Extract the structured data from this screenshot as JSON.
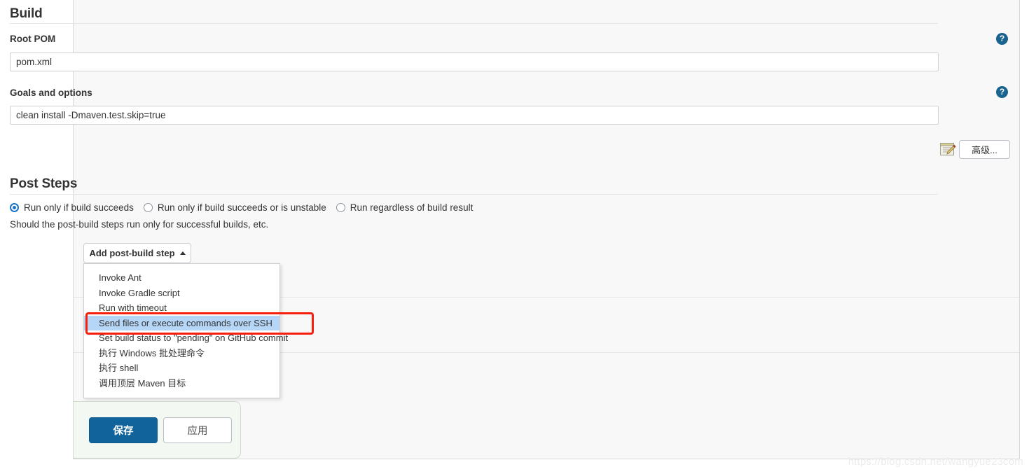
{
  "build_section": {
    "title": "Build",
    "root_pom": {
      "label": "Root POM",
      "value": "pom.xml",
      "help_icon": "help-circle-icon"
    },
    "goals": {
      "label": "Goals and options",
      "value": "clean install -Dmaven.test.skip=true",
      "help_icon": "help-circle-icon"
    },
    "advanced_button": "高级...",
    "notepad_icon": "notepad-edit-icon"
  },
  "post_steps_section": {
    "title": "Post Steps",
    "radios": [
      {
        "label": "Run only if build succeeds",
        "checked": true
      },
      {
        "label": "Run only if build succeeds or is unstable",
        "checked": false
      },
      {
        "label": "Run regardless of build result",
        "checked": false
      }
    ],
    "hint": "Should the post-build steps run only for successful builds, etc.",
    "dropdown": {
      "button_label": "Add post-build step",
      "caret_icon": "caret-up-icon",
      "open": true,
      "items": [
        {
          "label": "Invoke Ant",
          "selected": false
        },
        {
          "label": "Invoke Gradle script",
          "selected": false
        },
        {
          "label": "Run with timeout",
          "selected": false
        },
        {
          "label": "Send files or execute commands over SSH",
          "selected": true
        },
        {
          "label": "Set build status to \"pending\" on GitHub commit",
          "selected": false
        },
        {
          "label": "执行 Windows 批处理命令",
          "selected": false
        },
        {
          "label": "执行 shell",
          "selected": false
        },
        {
          "label": "调用顶层 Maven 目标",
          "selected": false
        }
      ]
    }
  },
  "footer": {
    "save_label": "保存",
    "apply_label": "应用"
  },
  "watermark": "https://blog.csdn.net/wangyue23com",
  "colors": {
    "accent_blue": "#10639b",
    "help_icon_blue": "#19638f",
    "radio_blue": "#1a73c8",
    "highlight_blue": "#b5d6f7",
    "annotation_red": "#f61f0c",
    "save_bar_green": "#f4f8f2"
  }
}
